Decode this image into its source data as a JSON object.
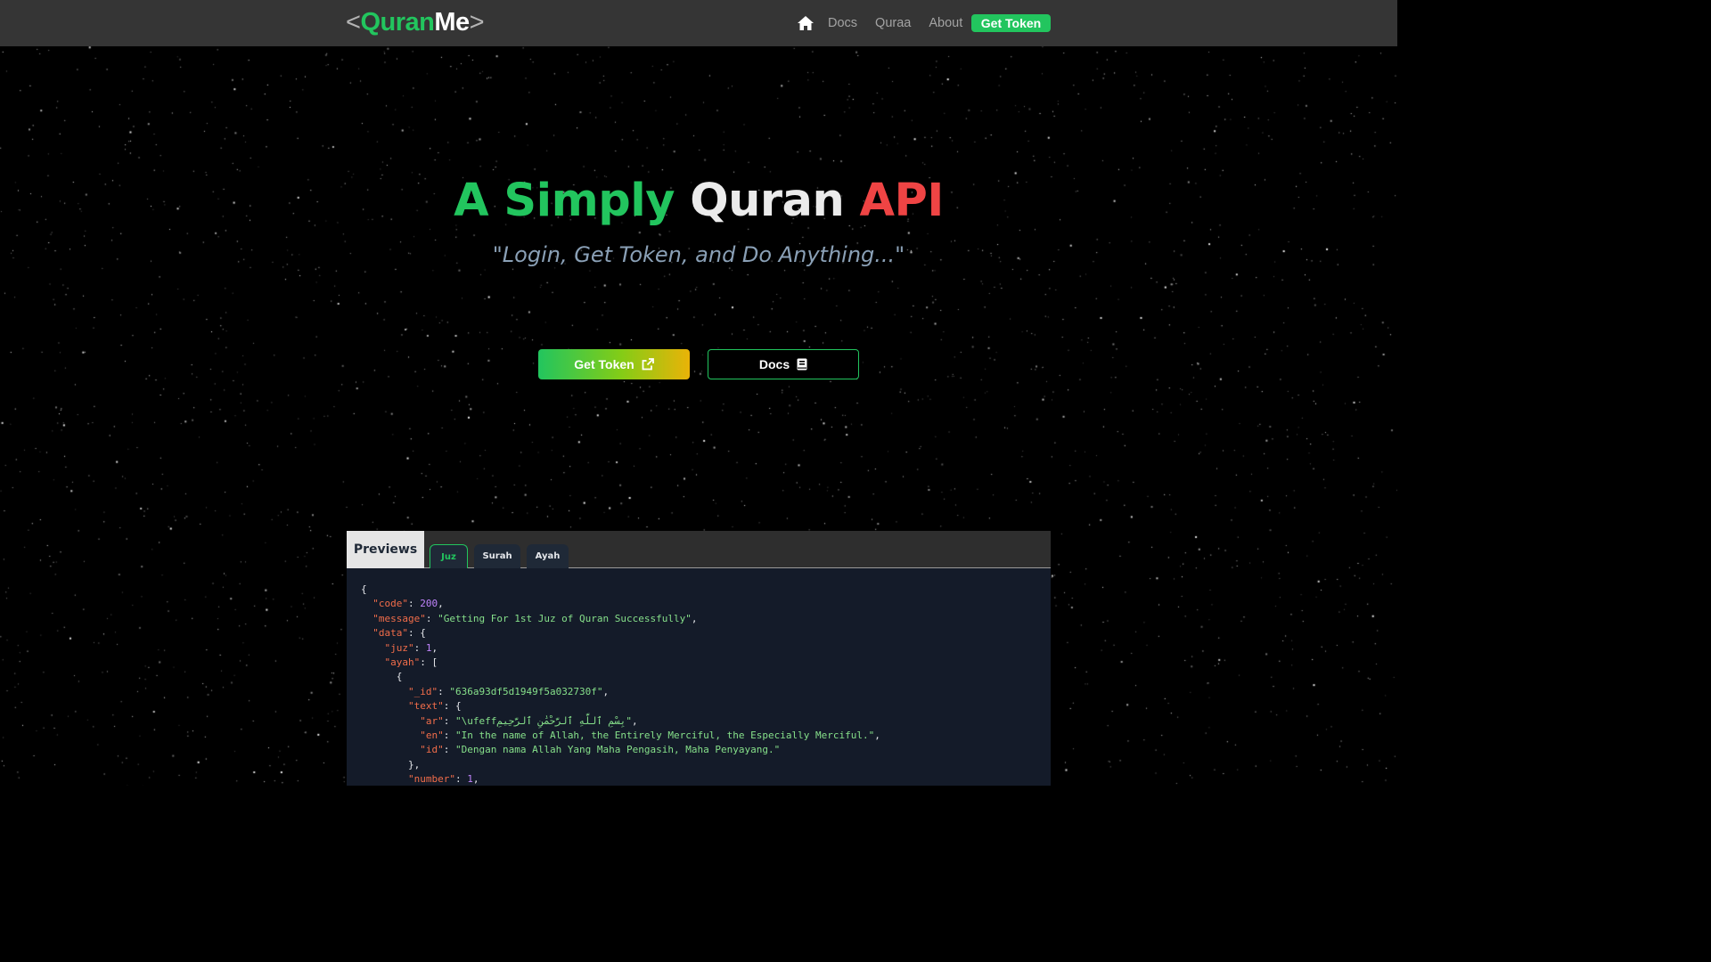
{
  "navbar": {
    "logo": {
      "open": "<",
      "part1": "Quran",
      "part2": "Me",
      "close": ">"
    },
    "home_icon": "home-icon",
    "links": [
      "Docs",
      "Quraa",
      "About"
    ],
    "cta": "Get Token"
  },
  "hero": {
    "title": {
      "word1": "A Simply",
      "word2": "Quran",
      "word3": "API"
    },
    "subtitle": "\"Login, Get Token, and Do Anything...\"",
    "primary_button": "Get Token",
    "primary_icon": "external-link-icon",
    "secondary_button": "Docs",
    "secondary_icon": "book-icon"
  },
  "preview": {
    "label": "Previews",
    "tabs": [
      "Juz",
      "Surah",
      "Ayah"
    ],
    "active_tab": "Juz",
    "code": {
      "code_key": "\"code\"",
      "code_val": "200",
      "message_key": "\"message\"",
      "message_val": "\"Getting For 1st Juz of Quran Successfully\"",
      "data_key": "\"data\"",
      "juz_key": "\"juz\"",
      "juz_val": "1",
      "ayah_key": "\"ayah\"",
      "id_key": "\"_id\"",
      "id_val": "\"636a93df5d1949f5a032730f\"",
      "text_key": "\"text\"",
      "ar_key": "\"ar\"",
      "ar_val": "\"\\ufeffبِسْمِ ٱللَّهِ ٱلرَّحْمَٰنِ ٱلرَّحِيمِ\"",
      "en_key": "\"en\"",
      "en_val": "\"In the name of Allah, the Entirely Merciful, the Especially Merciful.\"",
      "id2_key": "\"id\"",
      "id2_val": "\"Dengan nama Allah Yang Maha Pengasih, Maha Penyayang.\"",
      "number_key": "\"number\"",
      "number_val": "1"
    }
  },
  "colors": {
    "green": "#22c55e",
    "red": "#ef4444",
    "navbar_bg": "#353535",
    "code_bg": "#141b29"
  }
}
